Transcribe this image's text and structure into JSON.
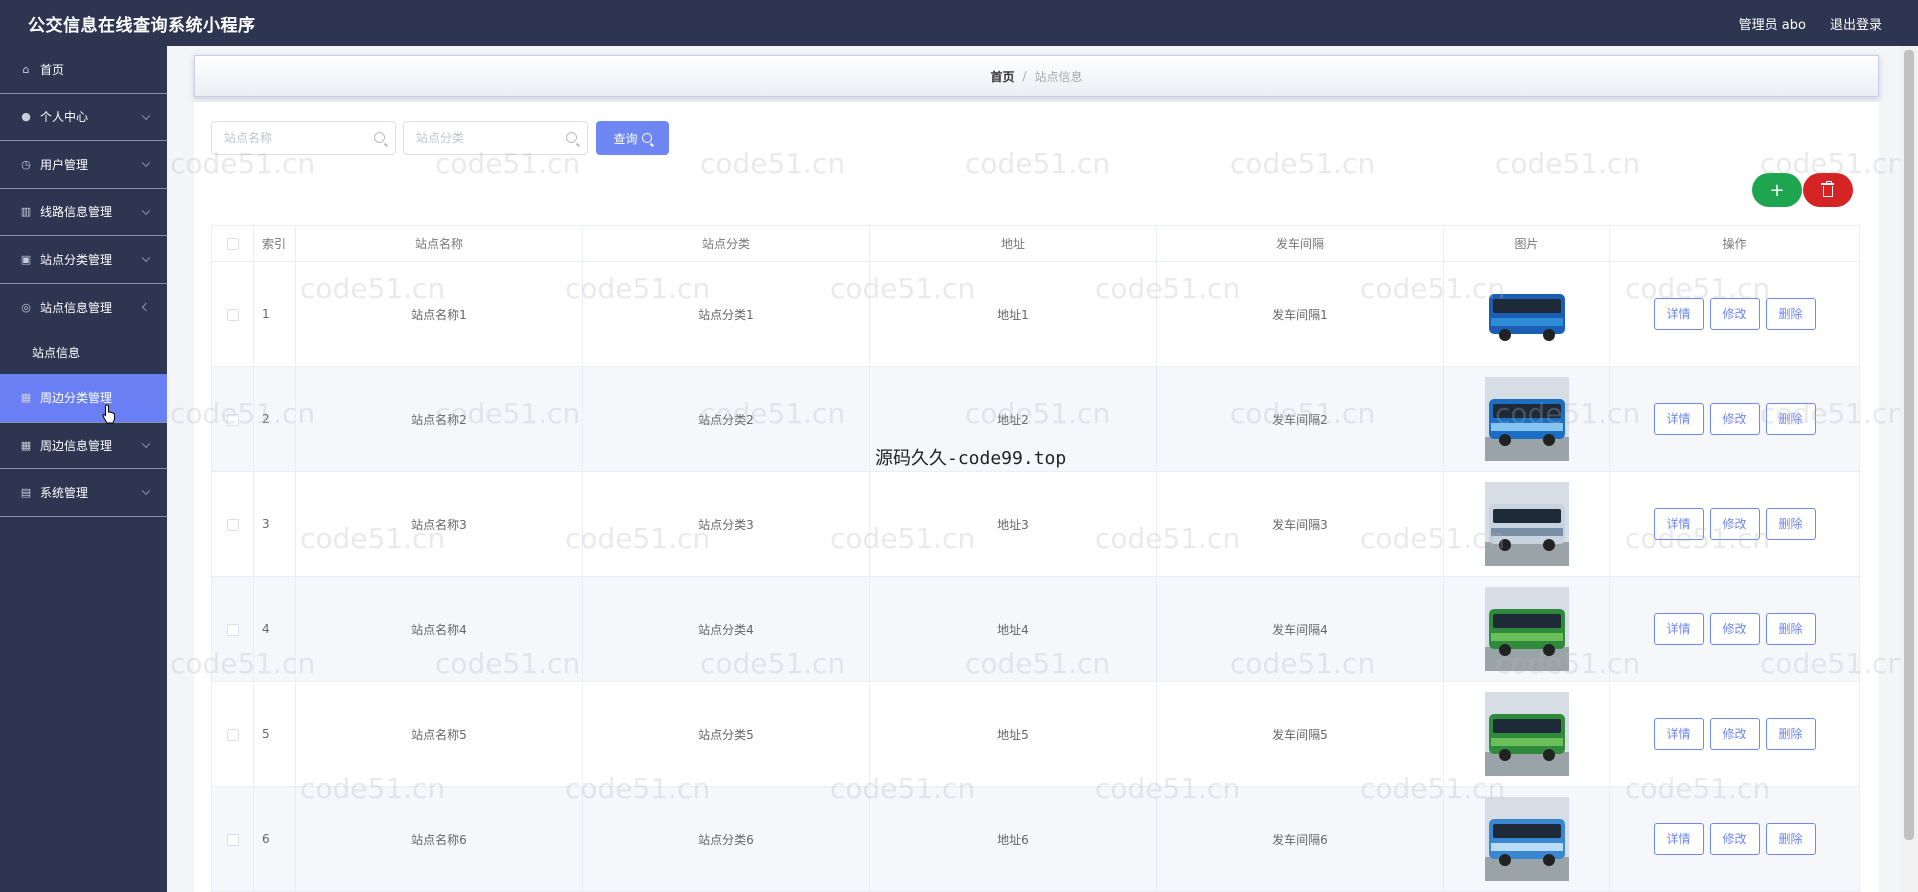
{
  "header": {
    "app_title": "公交信息在线查询系统小程序",
    "user_label": "管理员 abo",
    "logout_label": "退出登录"
  },
  "sidebar": {
    "items": [
      {
        "label": "首页",
        "icon": "home-icon"
      },
      {
        "label": "个人中心",
        "icon": "person-icon"
      },
      {
        "label": "用户管理",
        "icon": "clock-icon"
      },
      {
        "label": "线路信息管理",
        "icon": "chart-icon"
      },
      {
        "label": "站点分类管理",
        "icon": "clipboard-icon"
      },
      {
        "label": "站点信息管理",
        "icon": "compass-icon"
      },
      {
        "label": "站点信息",
        "icon": ""
      },
      {
        "label": "周边分类管理",
        "icon": "grid-icon"
      },
      {
        "label": "周边信息管理",
        "icon": "grid-icon"
      },
      {
        "label": "系统管理",
        "icon": "window-icon"
      }
    ]
  },
  "breadcrumb": {
    "home": "首页",
    "separator": "/",
    "current": "站点信息"
  },
  "search": {
    "name_placeholder": "站点名称",
    "category_placeholder": "站点分类",
    "query_label": "查询"
  },
  "table": {
    "headers": [
      "索引",
      "站点名称",
      "站点分类",
      "地址",
      "发车间隔",
      "图片",
      "操作"
    ],
    "rows": [
      {
        "index": "1",
        "name": "站点名称1",
        "category": "站点分类1",
        "address": "地址1",
        "interval": "发车间隔1"
      },
      {
        "index": "2",
        "name": "站点名称2",
        "category": "站点分类2",
        "address": "地址2",
        "interval": "发车间隔2"
      },
      {
        "index": "3",
        "name": "站点名称3",
        "category": "站点分类3",
        "address": "地址3",
        "interval": "发车间隔3"
      },
      {
        "index": "4",
        "name": "站点名称4",
        "category": "站点分类4",
        "address": "地址4",
        "interval": "发车间隔4"
      },
      {
        "index": "5",
        "name": "站点名称5",
        "category": "站点分类5",
        "address": "地址5",
        "interval": "发车间隔5"
      },
      {
        "index": "6",
        "name": "站点名称6",
        "category": "站点分类6",
        "address": "地址6",
        "interval": "发车间隔6"
      }
    ],
    "actions": {
      "detail": "详情",
      "edit": "修改",
      "delete": "删除"
    }
  },
  "watermark": {
    "text": "code51.cn",
    "center_text": "源码久久-code99.top"
  },
  "colors": {
    "sidebar_bg": "#2d3550",
    "accent": "#6e87f2",
    "add_button": "#1ea54f",
    "delete_button": "#d42424"
  }
}
